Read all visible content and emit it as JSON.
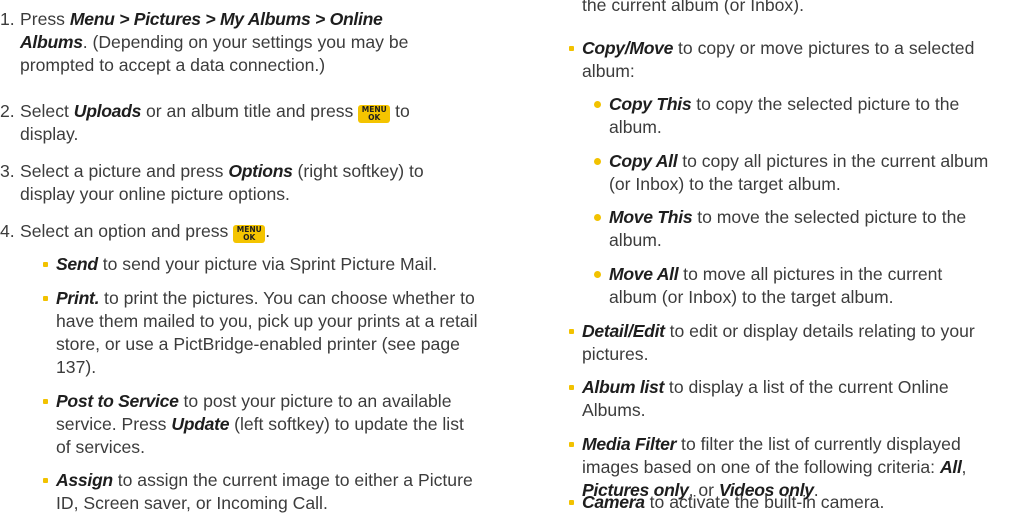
{
  "left": {
    "steps": [
      {
        "num": "1.",
        "text_before": "Press ",
        "menu_path": "Menu > Pictures > My Albums > Online Albums",
        "text_after": ". (Depending on your settings you may be prompted to accept a data connection.)"
      },
      {
        "num": "2.",
        "text_before": "Select ",
        "kw": "Uploads",
        "text_mid": " or an album title and press ",
        "text_after": " to display."
      },
      {
        "num": "3.",
        "text_before": "Select a picture and press ",
        "kw": "Options",
        "text_after": " (right softkey) to display your online picture options."
      },
      {
        "num": "4.",
        "text_before": "Select an option and press ",
        "text_after": "."
      }
    ],
    "options": [
      {
        "kw": "Send",
        "text": " to send your picture via Sprint Picture Mail."
      },
      {
        "kw": "Print.",
        "text": " to print the pictures. You can choose whether to have them mailed to you, pick up your prints at a retail store, or use a PictBridge-enabled printer (see page 137)."
      },
      {
        "kw": "Post to Service",
        "text_before": " to post your picture to an available service. Press ",
        "kw2": "Update",
        "text_after": " (left softkey) to update the list of services."
      },
      {
        "kw": "Assign",
        "text": " to assign the current image to either a Picture ID, Screen saver, or Incoming Call."
      }
    ]
  },
  "right": {
    "cont_text": "the current album (or Inbox).",
    "copy_move": {
      "kw": "Copy/Move",
      "text": " to copy or move pictures to a selected album:"
    },
    "sub_options": [
      {
        "kw": "Copy This",
        "text": " to copy the selected picture to the album."
      },
      {
        "kw": "Copy All",
        "text": " to copy all pictures in the current album (or Inbox) to the target album."
      },
      {
        "kw": "Move This",
        "text": " to move the selected picture to the album."
      },
      {
        "kw": "Move All",
        "text": " to move all pictures in the current album (or Inbox) to the target album."
      }
    ],
    "options": [
      {
        "kw": "Detail/Edit",
        "text": " to edit or display details relating to your pictures."
      },
      {
        "kw": "Album list",
        "text": " to display a list of the current Online Albums."
      },
      {
        "kw": "Media Filter",
        "text_before": " to filter the list of currently displayed images based on one of the following criteria: ",
        "kw2": "All",
        "mid": ", ",
        "kw3": "Pictures only",
        "mid2": ", or ",
        "kw4": "Videos only",
        "text_after": "."
      },
      {
        "kw": "Camera",
        "text": " to activate the built-in camera."
      }
    ]
  },
  "key": {
    "line1": "MENU",
    "line2": "OK"
  }
}
